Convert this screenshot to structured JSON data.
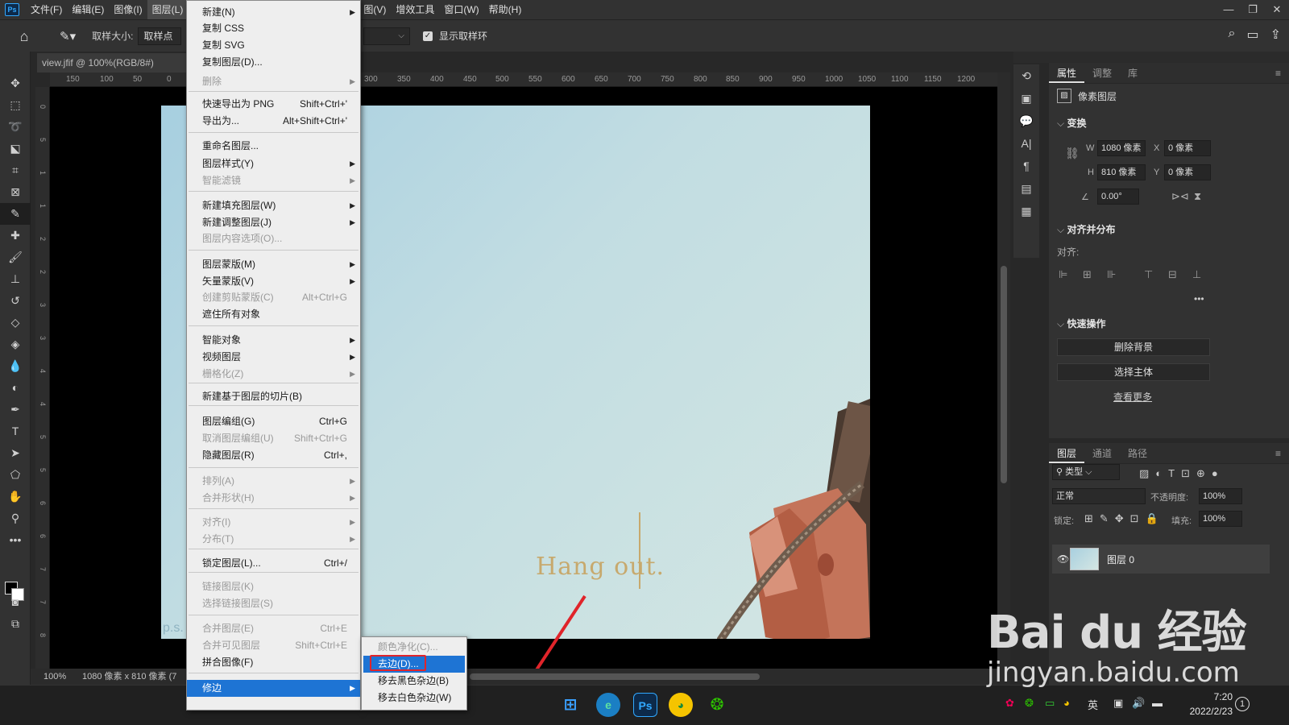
{
  "menubar": {
    "logo": "Ps",
    "items": [
      "文件(F)",
      "编辑(E)",
      "图像(I)",
      "图层(L)",
      "图(V)",
      "增效工具",
      "窗口(W)",
      "帮助(H)"
    ],
    "win_controls": [
      "—",
      "❐",
      "✕"
    ]
  },
  "options": {
    "sample_size_label": "取样大小:",
    "sample_size_value": "取样点",
    "show_ring_label": "显示取样环"
  },
  "document": {
    "tab_title": "view.jfif @ 100%(RGB/8#)",
    "tab_close": "✕",
    "ruler_top": [
      "150",
      "100",
      "50",
      "0",
      "300",
      "350",
      "400",
      "450",
      "500",
      "550",
      "600",
      "650",
      "700",
      "750",
      "800",
      "850",
      "900",
      "950",
      "1000",
      "1050",
      "1100",
      "1150",
      "1200"
    ],
    "ruler_left": [
      "0",
      "5",
      "1",
      "1",
      "2",
      "2",
      "3",
      "3",
      "4",
      "4",
      "5",
      "5",
      "6",
      "6",
      "7",
      "7",
      "8"
    ],
    "art_text": "Hang out.",
    "ps_mark": "p.s.",
    "zoom": "100%",
    "size_info": "1080 像素 x 810 像素 (7"
  },
  "layer_menu": {
    "items": [
      {
        "label": "新建(N)",
        "sub": true
      },
      {
        "label": "复制 CSS"
      },
      {
        "label": "复制 SVG"
      },
      {
        "label": "复制图层(D)..."
      },
      {
        "label": "删除",
        "sub": true,
        "disabled": true
      },
      {
        "label": "快速导出为 PNG",
        "shortcut": "Shift+Ctrl+'"
      },
      {
        "label": "导出为...",
        "shortcut": "Alt+Shift+Ctrl+'"
      },
      {
        "label": "重命名图层..."
      },
      {
        "label": "图层样式(Y)",
        "sub": true
      },
      {
        "label": "智能滤镜",
        "sub": true,
        "disabled": true
      },
      {
        "label": "新建填充图层(W)",
        "sub": true
      },
      {
        "label": "新建调整图层(J)",
        "sub": true
      },
      {
        "label": "图层内容选项(O)...",
        "disabled": true
      },
      {
        "label": "图层蒙版(M)",
        "sub": true
      },
      {
        "label": "矢量蒙版(V)",
        "sub": true
      },
      {
        "label": "创建剪贴蒙版(C)",
        "shortcut": "Alt+Ctrl+G",
        "disabled": true
      },
      {
        "label": "遮住所有对象"
      },
      {
        "label": "智能对象",
        "sub": true
      },
      {
        "label": "视频图层",
        "sub": true
      },
      {
        "label": "栅格化(Z)",
        "sub": true,
        "disabled": true
      },
      {
        "label": "新建基于图层的切片(B)"
      },
      {
        "label": "图层编组(G)",
        "shortcut": "Ctrl+G"
      },
      {
        "label": "取消图层编组(U)",
        "shortcut": "Shift+Ctrl+G",
        "disabled": true
      },
      {
        "label": "隐藏图层(R)",
        "shortcut": "Ctrl+,"
      },
      {
        "label": "排列(A)",
        "sub": true,
        "disabled": true
      },
      {
        "label": "合并形状(H)",
        "sub": true,
        "disabled": true
      },
      {
        "label": "对齐(I)",
        "sub": true,
        "disabled": true
      },
      {
        "label": "分布(T)",
        "sub": true,
        "disabled": true
      },
      {
        "label": "锁定图层(L)...",
        "shortcut": "Ctrl+/"
      },
      {
        "label": "链接图层(K)",
        "disabled": true
      },
      {
        "label": "选择链接图层(S)",
        "disabled": true
      },
      {
        "label": "合并图层(E)",
        "shortcut": "Ctrl+E",
        "disabled": true
      },
      {
        "label": "合并可见图层",
        "shortcut": "Shift+Ctrl+E",
        "disabled": true
      },
      {
        "label": "拼合图像(F)"
      },
      {
        "label": "修边",
        "sub": true,
        "highlighted": true
      }
    ]
  },
  "submenu": {
    "items": [
      {
        "label": "颜色净化(C)...",
        "disabled": true
      },
      {
        "label": "去边(D)...",
        "highlighted": true
      },
      {
        "label": "移去黑色杂边(B)"
      },
      {
        "label": "移去白色杂边(W)"
      }
    ]
  },
  "properties": {
    "tabs": [
      "属性",
      "调整",
      "库"
    ],
    "layer_type": "像素图层",
    "transform_title": "变换",
    "w_label": "W",
    "w_value": "1080 像素",
    "x_label": "X",
    "x_value": "0 像素",
    "h_label": "H",
    "h_value": "810 像素",
    "y_label": "Y",
    "y_value": "0 像素",
    "angle_value": "0.00°",
    "align_title": "对齐并分布",
    "align_label": "对齐:",
    "more": "•••",
    "quick_title": "快速操作",
    "remove_bg": "删除背景",
    "select_subject": "选择主体",
    "see_more": "查看更多"
  },
  "layers": {
    "tabs": [
      "图层",
      "通道",
      "路径"
    ],
    "filter_kind": "类型",
    "blend_mode": "正常",
    "opacity_label": "不透明度:",
    "opacity_value": "100%",
    "lock_label": "锁定:",
    "fill_label": "填充:",
    "fill_value": "100%",
    "layer_name": "图层 0"
  },
  "taskbar": {
    "lang": "英",
    "time": "7:20",
    "date": "2022/2/23",
    "notif": "1"
  },
  "watermark": {
    "logo": "Bai du 经验",
    "url": "jingyan.baidu.com"
  },
  "colors": {
    "menu_highlight": "#1e74d4",
    "red_annotation": "#e0242a"
  }
}
